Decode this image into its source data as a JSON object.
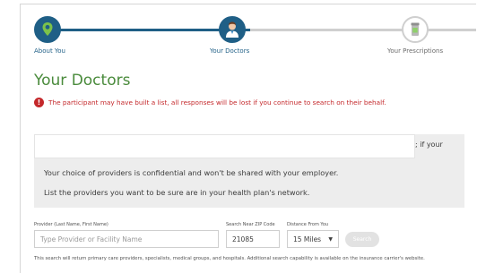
{
  "stepper": {
    "steps": [
      {
        "label": "About You",
        "status": "complete",
        "icon": "person-pin-icon"
      },
      {
        "label": "Your Doctors",
        "status": "current",
        "icon": "doctor-icon"
      },
      {
        "label": "Your Prescriptions",
        "status": "upcoming",
        "icon": "prescription-bottle-icon"
      }
    ]
  },
  "page": {
    "title": "Your Doctors",
    "warning": "The participant may have built a list, all responses will be lost if you continue to search on their behalf."
  },
  "info": {
    "fragment": "; if your",
    "line1": "Your choice of providers is confidential and won't be shared with your employer.",
    "line2": "List the providers you want to be sure are in your health plan's network."
  },
  "search": {
    "provider_label": "Provider (Last Name, First Name)",
    "provider_placeholder": "Type Provider or Facility Name",
    "zip_label": "Search Near ZIP Code",
    "zip_value": "21085",
    "distance_label": "Distance From You",
    "distance_value": "15 Miles",
    "button_label": "Search",
    "footnote": "This search will return primary care providers, specialists, medical groups, and hospitals. Additional search capability is available on the insurance carrier's website."
  },
  "colors": {
    "primary": "#1f5f86",
    "title_green": "#4a8b3c",
    "warning_red": "#c4282b"
  }
}
